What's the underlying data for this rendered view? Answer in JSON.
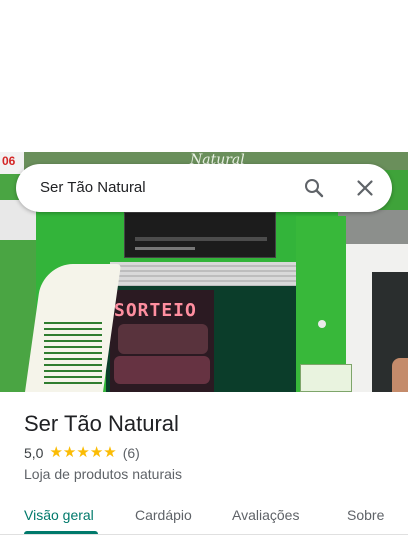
{
  "search": {
    "query": "Ser Tão Natural",
    "search_icon": "search-icon",
    "close_icon": "close-icon"
  },
  "photo": {
    "storefront_sign": "Natural",
    "shop_number": "06",
    "window_text": "SORTEIO"
  },
  "place": {
    "name": "Ser Tão Natural",
    "rating": "5,0",
    "stars": 5,
    "review_count": "(6)",
    "category": "Loja de produtos naturais"
  },
  "tabs": [
    {
      "label": "Visão geral",
      "active": true
    },
    {
      "label": "Cardápio",
      "active": false
    },
    {
      "label": "Avaliações",
      "active": false
    },
    {
      "label": "Sobre",
      "active": false
    }
  ],
  "colors": {
    "accent": "#00796b",
    "star": "#fbbc04"
  }
}
